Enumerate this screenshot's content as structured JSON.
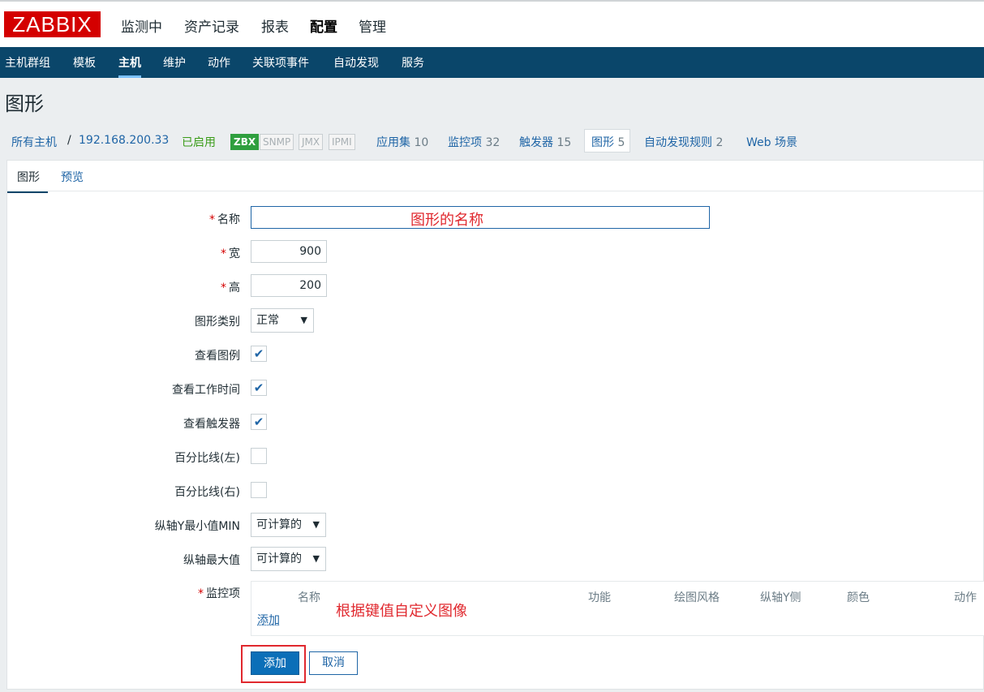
{
  "logo": "ZABBIX",
  "top_menu": [
    "监测中",
    "资产记录",
    "报表",
    "配置",
    "管理"
  ],
  "top_menu_active": "配置",
  "sub_menu": [
    "主机群组",
    "模板",
    "主机",
    "维护",
    "动作",
    "关联项事件",
    "自动发现",
    "服务"
  ],
  "sub_menu_active": "主机",
  "page_title": "图形",
  "host_bar": {
    "all_hosts": "所有主机",
    "separator": "/",
    "host": "192.168.200.33",
    "status": "已启用",
    "badges": [
      "ZBX",
      "SNMP",
      "JMX",
      "IPMI"
    ],
    "links": [
      {
        "label": "应用集",
        "count": "10"
      },
      {
        "label": "监控项",
        "count": "32"
      },
      {
        "label": "触发器",
        "count": "15"
      },
      {
        "label": "图形",
        "count": "5"
      },
      {
        "label": "自动发现规则",
        "count": "2"
      },
      {
        "label": "Web 场景",
        "count": ""
      }
    ]
  },
  "form_tabs": [
    "图形",
    "预览"
  ],
  "form": {
    "name_label": "名称",
    "name_value": "",
    "width_label": "宽",
    "width_value": "900",
    "height_label": "高",
    "height_value": "200",
    "graph_type_label": "图形类别",
    "graph_type_value": "正常",
    "show_legend_label": "查看图例",
    "show_working_time_label": "查看工作时间",
    "show_triggers_label": "查看触发器",
    "percentile_left_label": "百分比线(左)",
    "percentile_right_label": "百分比线(右)",
    "y_min_label": "纵轴Y最小值MIN",
    "y_min_value": "可计算的",
    "y_max_label": "纵轴最大值",
    "y_max_value": "可计算的",
    "items_label": "监控项",
    "required_mark": "*",
    "checkbox_mark": "✔"
  },
  "checkboxes": {
    "show_legend": true,
    "show_working_time": true,
    "show_triggers": true,
    "percentile_left": false,
    "percentile_right": false
  },
  "items_table": {
    "headers": [
      "名称",
      "功能",
      "绘图风格",
      "纵轴Y侧",
      "颜色",
      "动作"
    ],
    "add_link": "添加"
  },
  "annotations": {
    "name_hint": "图形的名称",
    "items_hint": "根据键值自定义图像"
  },
  "buttons": {
    "add": "添加",
    "cancel": "取消"
  },
  "colors": {
    "brand_red": "#d40000",
    "nav_bg": "#0a466a",
    "link_blue": "#1f65a6",
    "annotation_red": "#e0282e",
    "enabled_green": "#3a9c19"
  }
}
